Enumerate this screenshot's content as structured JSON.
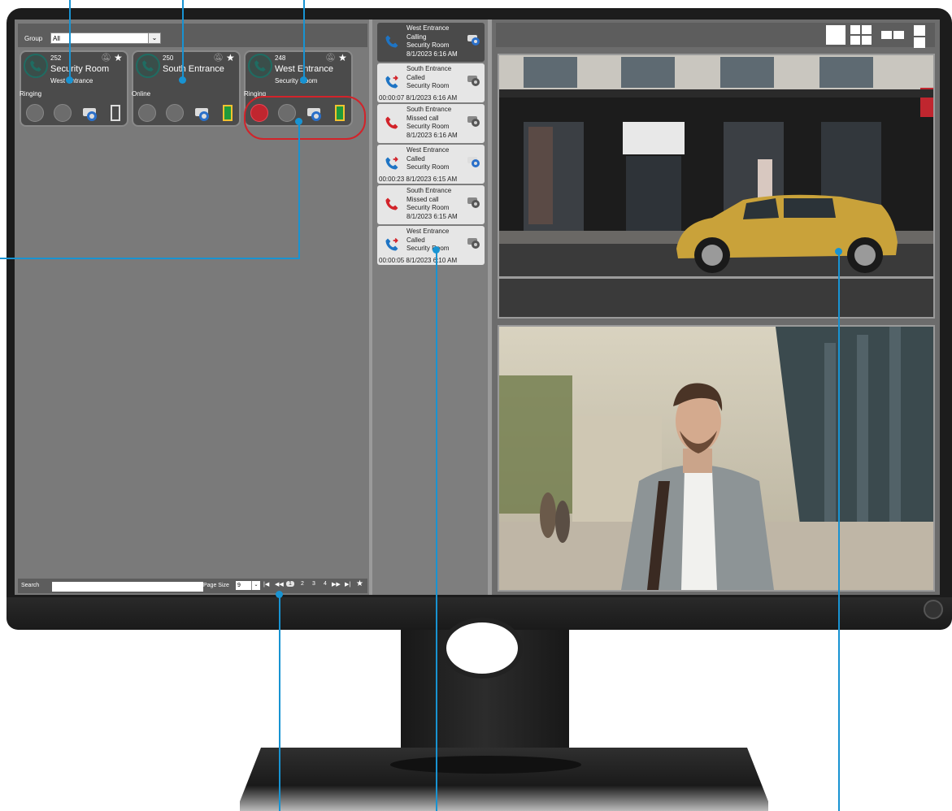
{
  "group": {
    "label": "Group",
    "selected": "All"
  },
  "devices": [
    {
      "number": "252",
      "name": "Security Room",
      "sub": "West Entrance",
      "status": "Ringing"
    },
    {
      "number": "250",
      "name": "South Entrance",
      "sub": "",
      "status": "Online"
    },
    {
      "number": "248",
      "name": "West Entrance",
      "sub": "Security Room",
      "status": "Ringing"
    }
  ],
  "bottom_bar": {
    "search_label": "Search",
    "page_size_label": "Page Size",
    "page_size_value": "9",
    "pages": [
      "1",
      "2",
      "3",
      "4"
    ],
    "current_page": "1"
  },
  "call_log": [
    {
      "from": "West Entrance",
      "state": "Calling",
      "to": "Security Room",
      "time": "8/1/2023 6:16 AM",
      "duration": "",
      "kind": "active"
    },
    {
      "from": "South Entrance",
      "state": "Called",
      "to": "Security Room",
      "time": "6:16 AM",
      "duration": "00:00:07 8/1/2023",
      "kind": "called"
    },
    {
      "from": "South Entrance",
      "state": "Missed call",
      "to": "Security Room",
      "time": "8/1/2023 6:16 AM",
      "duration": "",
      "kind": "missed"
    },
    {
      "from": "West Entrance",
      "state": "Called",
      "to": "Security Room",
      "time": "6:15 AM",
      "duration": "00:00:23 8/1/2023",
      "kind": "called"
    },
    {
      "from": "South Entrance",
      "state": "Missed call",
      "to": "Security Room",
      "time": "8/1/2023 6:15 AM",
      "duration": "",
      "kind": "missed"
    },
    {
      "from": "West Entrance",
      "state": "Called",
      "to": "Security Room",
      "time": "6:10 AM",
      "duration": "00:00:05 8/1/2023",
      "kind": "called"
    }
  ],
  "colors": {
    "accent_line": "#1893d2",
    "call_blue": "#1e74c4",
    "call_red": "#d2232a",
    "door_green": "#1e9a3c",
    "door_frame": "#f2c230"
  },
  "icons": [
    "phone-icon",
    "bell-mute-icon",
    "star-icon",
    "answer-icon",
    "transfer-icon",
    "camera-icon",
    "door-icon",
    "first-page-icon",
    "prev-page-icon",
    "next-page-icon",
    "last-page-icon",
    "layout-1-icon",
    "layout-4-icon",
    "layout-2-icon",
    "layout-2v-icon"
  ]
}
